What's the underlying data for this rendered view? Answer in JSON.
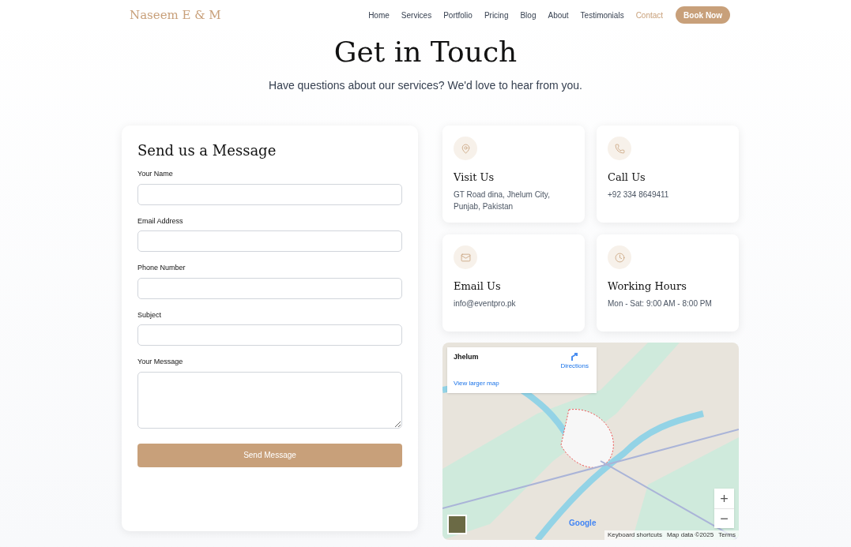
{
  "brand": "Naseem E & M",
  "nav": [
    {
      "label": "Home",
      "selected": false
    },
    {
      "label": "Services",
      "selected": false
    },
    {
      "label": "Portfolio",
      "selected": false
    },
    {
      "label": "Pricing",
      "selected": false
    },
    {
      "label": "Blog",
      "selected": false
    },
    {
      "label": "About",
      "selected": false
    },
    {
      "label": "Testimonials",
      "selected": false
    },
    {
      "label": "Contact",
      "selected": true
    }
  ],
  "cta": "Book Now",
  "hero": {
    "title": "Get in Touch",
    "subtitle": "Have questions about our services? We'd love to hear from you."
  },
  "form": {
    "title": "Send us a Message",
    "fields": [
      {
        "label": "Your Name",
        "kind": "text"
      },
      {
        "label": "Email Address",
        "kind": "text"
      },
      {
        "label": "Phone Number",
        "kind": "text"
      },
      {
        "label": "Subject",
        "kind": "text"
      },
      {
        "label": "Your Message",
        "kind": "textarea"
      }
    ],
    "submit": "Send Message"
  },
  "info_cards": [
    {
      "kind": "location",
      "title": "Visit Us",
      "text": "GT Road dina, Jhelum City, Punjab, Pakistan"
    },
    {
      "kind": "phone",
      "title": "Call Us",
      "text": "+92 334 8649411"
    },
    {
      "kind": "email",
      "title": "Email Us",
      "text": "info@eventpro.pk"
    },
    {
      "kind": "clock",
      "title": "Working Hours",
      "text": "Mon - Sat: 9:00 AM - 8:00 PM"
    }
  ],
  "map": {
    "place": "Jhelum",
    "directions": "Directions",
    "larger_map": "View larger map",
    "zoom_in": "+",
    "zoom_out": "−",
    "logo": "Google",
    "footer": [
      "Keyboard shortcuts",
      "Map data ©2025",
      "Terms"
    ]
  }
}
